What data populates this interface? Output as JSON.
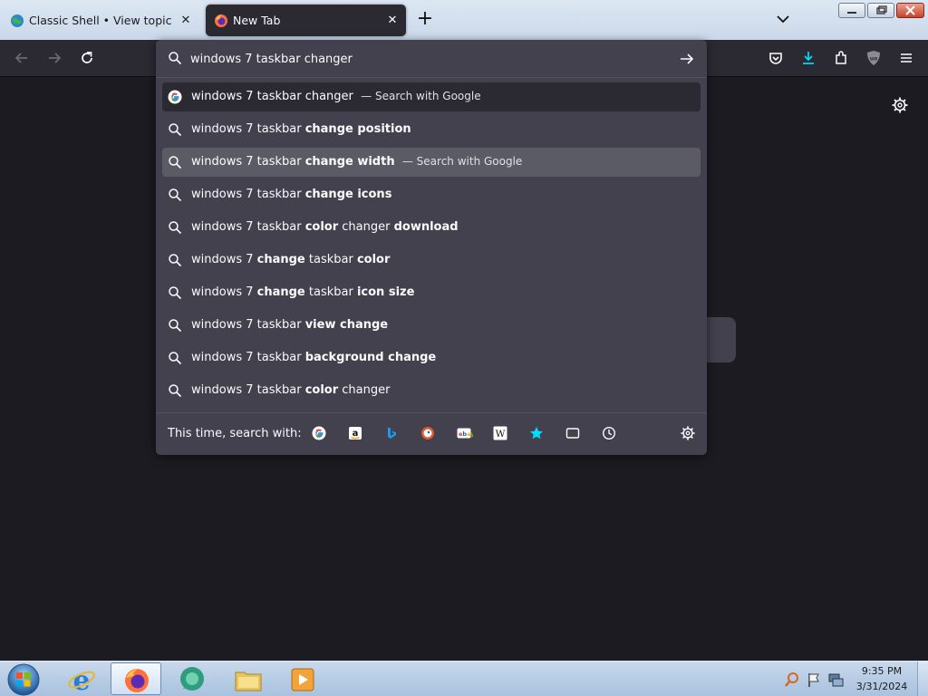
{
  "tabs": [
    {
      "title": "Classic Shell • View topic - Orig",
      "icon": "globe-icon",
      "active": false
    },
    {
      "title": "New Tab",
      "icon": "firefox-icon",
      "active": true
    }
  ],
  "urlbar": {
    "value": "windows 7 taskbar changer"
  },
  "suggestions": [
    {
      "parts": [
        [
          "windows 7 taskbar changer",
          false
        ]
      ],
      "suffix": "— Search with Google",
      "icon": "google-icon",
      "state": "selected"
    },
    {
      "parts": [
        [
          "windows 7 taskbar ",
          false
        ],
        [
          "change position",
          true
        ]
      ],
      "suffix": "",
      "icon": "search-icon",
      "state": ""
    },
    {
      "parts": [
        [
          "windows 7 taskbar ",
          false
        ],
        [
          "change width",
          true
        ]
      ],
      "suffix": "— Search with Google",
      "icon": "search-icon",
      "state": "hover"
    },
    {
      "parts": [
        [
          "windows 7 taskbar ",
          false
        ],
        [
          "change icons",
          true
        ]
      ],
      "suffix": "",
      "icon": "search-icon",
      "state": ""
    },
    {
      "parts": [
        [
          "windows 7 taskbar ",
          false
        ],
        [
          "color",
          true
        ],
        [
          " changer ",
          false
        ],
        [
          "download",
          true
        ]
      ],
      "suffix": "",
      "icon": "search-icon",
      "state": ""
    },
    {
      "parts": [
        [
          "windows 7 ",
          false
        ],
        [
          "change",
          true
        ],
        [
          " taskbar ",
          false
        ],
        [
          "color",
          true
        ]
      ],
      "suffix": "",
      "icon": "search-icon",
      "state": ""
    },
    {
      "parts": [
        [
          "windows 7 ",
          false
        ],
        [
          "change",
          true
        ],
        [
          " taskbar ",
          false
        ],
        [
          "icon size",
          true
        ]
      ],
      "suffix": "",
      "icon": "search-icon",
      "state": ""
    },
    {
      "parts": [
        [
          "windows 7 taskbar ",
          false
        ],
        [
          "view change",
          true
        ]
      ],
      "suffix": "",
      "icon": "search-icon",
      "state": ""
    },
    {
      "parts": [
        [
          "windows 7 taskbar ",
          false
        ],
        [
          "background change",
          true
        ]
      ],
      "suffix": "",
      "icon": "search-icon",
      "state": ""
    },
    {
      "parts": [
        [
          "windows 7 taskbar ",
          false
        ],
        [
          "color",
          true
        ],
        [
          " changer",
          false
        ]
      ],
      "suffix": "",
      "icon": "search-icon",
      "state": ""
    }
  ],
  "oneoff": {
    "label": "This time, search with:",
    "engines": [
      "google-icon",
      "amazon-icon",
      "bing-icon",
      "duckduckgo-icon",
      "ebay-icon",
      "wikipedia-icon",
      "bookmarks-icon",
      "tabs-icon",
      "history-icon"
    ]
  },
  "taskbar": {
    "time": "9:35 PM",
    "date": "3/31/2024"
  },
  "colors": {
    "accent": "#0df",
    "page_bg": "#1c1b22",
    "panel_bg": "#42414d",
    "toolbar_bg": "#2b2a33"
  }
}
